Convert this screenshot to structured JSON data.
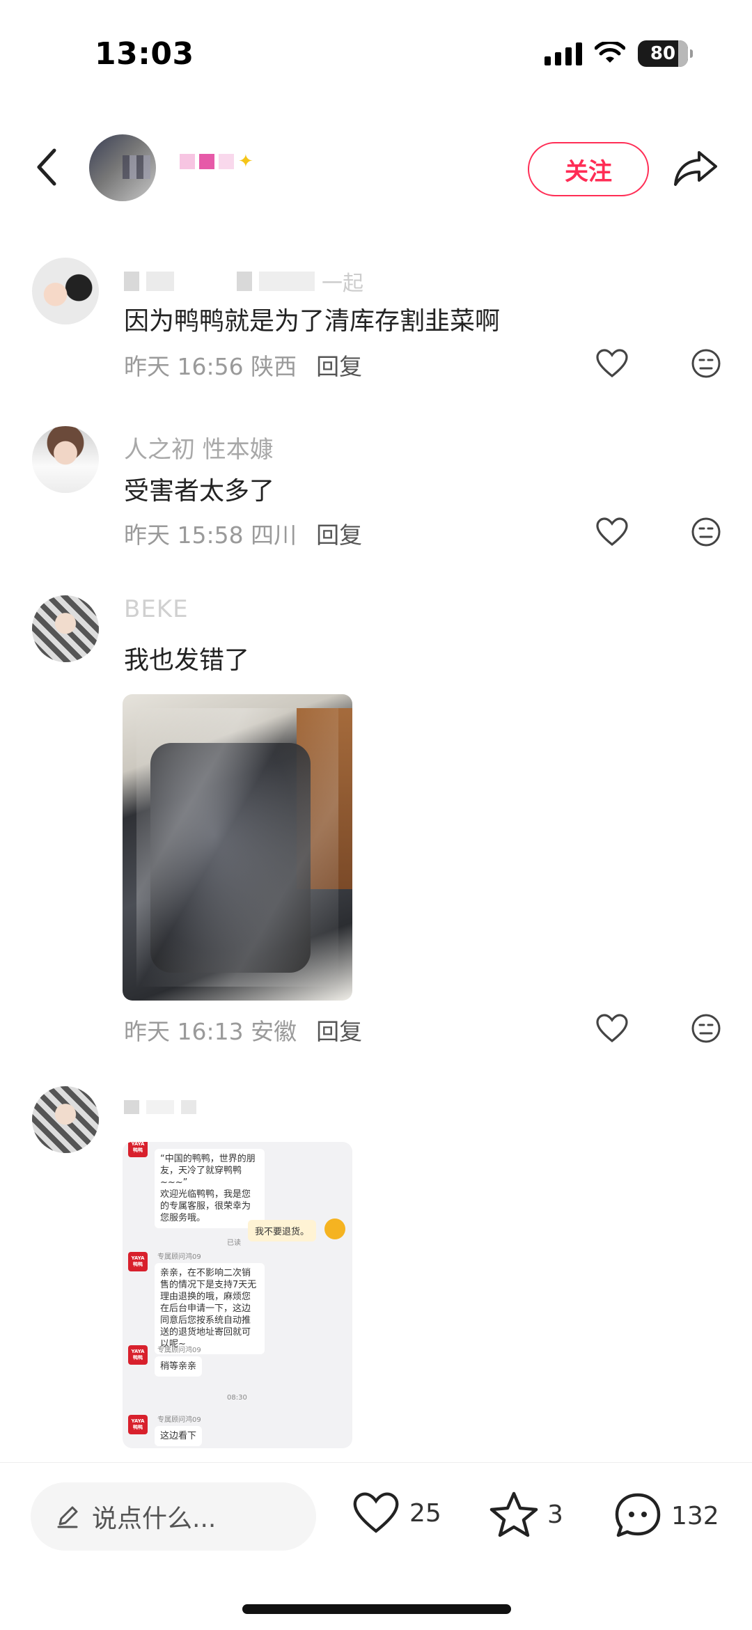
{
  "status_bar": {
    "time": "13:03",
    "battery": "80"
  },
  "header": {
    "follow_label": "关注"
  },
  "comments": [
    {
      "name": "",
      "name_partial": "一起",
      "text": "因为鸭鸭就是为了清库存割韭菜啊",
      "time": "昨天 16:56",
      "location": "陕西",
      "reply_label": "回复"
    },
    {
      "name": "人之初 性本嫝",
      "text": "受害者太多了",
      "time": "昨天 15:58",
      "location": "四川",
      "reply_label": "回复"
    },
    {
      "name": "BEKE",
      "text": "我也发错了",
      "time": "昨天 16:13",
      "location": "安徽",
      "reply_label": "回复"
    },
    {
      "name": "",
      "chat_screenshot": {
        "greeting": "“中国的鸭鸭，世界的朋友，天冷了就穿鸭鸭~~~”\n欢迎光临鸭鸭，我是您的专属客服，很荣幸为您服务哦。",
        "read_label": "已读",
        "my_message": "我不要退货。",
        "agent_name": "专属顾问鸿09",
        "reply1": "亲亲，在不影响二次销售的情况下是支持7天无理由退换的哦，麻烦您在后台申请一下，这边同意后您按系统自动推送的退货地址寄回就可以呢~",
        "reply2": "稍等亲亲",
        "timestamp": "08:30",
        "reply3": "这边看下",
        "logo_text": "YAYA 鸭鸭"
      }
    }
  ],
  "bottom_bar": {
    "input_placeholder": "说点什么...",
    "likes": "25",
    "favorites": "3",
    "comments": "132"
  },
  "colors": {
    "accent": "#ff2d55",
    "meta": "#9a9a9a"
  },
  "icons": [
    "back-icon",
    "share-icon",
    "heart-icon",
    "dislike-face-icon",
    "pencil-icon",
    "star-icon",
    "comment-bubble-icon",
    "signal-icon",
    "wifi-icon",
    "battery-icon"
  ]
}
